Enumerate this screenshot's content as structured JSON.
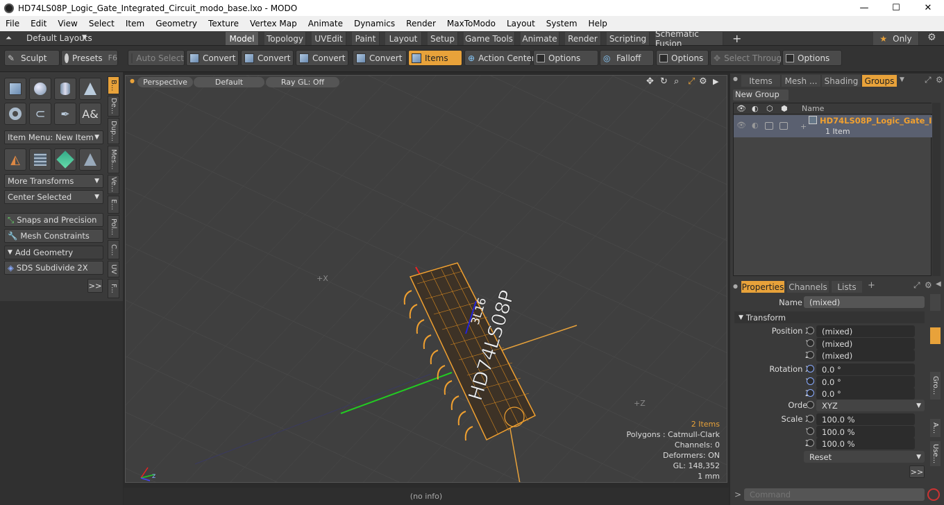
{
  "window": {
    "title": "HD74LS08P_Logic_Gate_Integrated_Circuit_modo_base.lxo - MODO",
    "min": "—",
    "max": "☐",
    "close": "✕"
  },
  "menu": [
    "File",
    "Edit",
    "View",
    "Select",
    "Item",
    "Geometry",
    "Texture",
    "Vertex Map",
    "Animate",
    "Dynamics",
    "Render",
    "MaxToModo",
    "Layout",
    "System",
    "Help"
  ],
  "layouts": {
    "label": "Default Layouts"
  },
  "tabs": [
    "Model",
    "Topology",
    "UVEdit",
    "Paint",
    "Layout",
    "Setup",
    "Game Tools",
    "Animate",
    "Render",
    "Scripting",
    "Schematic Fusion"
  ],
  "tabs_extra": {
    "add": "+",
    "only": "Only"
  },
  "toolbar": {
    "sculpt": "Sculpt",
    "presets": "Presets",
    "presets_key": "F6",
    "auto_select": "Auto Select",
    "convert1": "Convert",
    "convert2": "Convert",
    "convert3": "Convert",
    "convert4": "Convert",
    "items": "Items",
    "action_center": "Action Center",
    "options1": "Options",
    "falloff": "Falloff",
    "options2": "Options",
    "select_through": "Select Through",
    "options3": "Options"
  },
  "left": {
    "item_menu": "Item Menu: New Item",
    "more_transforms": "More Transforms",
    "center_selected": "Center Selected",
    "snaps": "Snaps and Precision",
    "mesh_constraints": "Mesh Constraints",
    "add_geometry": "Add Geometry",
    "sds": "SDS Subdivide 2X",
    "more": ">>",
    "vtabs": [
      "B...",
      "De...",
      "Dup...",
      "Mes...",
      "Ve...",
      "E...",
      "Pol...",
      "C...",
      "UV",
      "F..."
    ]
  },
  "viewport": {
    "perspective": "Perspective",
    "default": "Default",
    "raygl": "Ray GL: Off",
    "stats": {
      "items": "2 Items",
      "polygons": "Polygons : Catmull-Clark",
      "channels": "Channels: 0",
      "deformers": "Deformers: ON",
      "gl": "GL: 148,352",
      "unit": "1 mm"
    },
    "chip_text": "HD74LS08P",
    "chip_code": "3L16"
  },
  "status": {
    "info": "(no info)"
  },
  "groups": {
    "tabs": [
      "Items",
      "Mesh ...",
      "Shading",
      "Groups"
    ],
    "new_group": "New Group",
    "col_name": "Name",
    "row_name": "HD74LS08P_Logic_Gate_I...",
    "row_sub": "1 Item"
  },
  "props": {
    "tabs": [
      "Properties",
      "Channels",
      "Lists"
    ],
    "name_label": "Name",
    "name_value": "(mixed)",
    "transform": "Transform",
    "pos_x_label": "Position X",
    "pos_x": "(mixed)",
    "pos_y": "(mixed)",
    "pos_z": "(mixed)",
    "rot_x_label": "Rotation X",
    "rot_x": "0.0 °",
    "rot_y": "0.0 °",
    "rot_z": "0.0 °",
    "order_label": "Order",
    "order": "XYZ",
    "scale_x_label": "Scale X",
    "scale_x": "100.0 %",
    "scale_y": "100.0 %",
    "scale_z": "100.0 %",
    "y": "Y",
    "z": "Z",
    "reset": "Reset",
    "more": ">>",
    "side_tabs": [
      "Gro...",
      "A...",
      "Use..."
    ]
  },
  "command": {
    "placeholder": "Command",
    "prompt": ">"
  }
}
